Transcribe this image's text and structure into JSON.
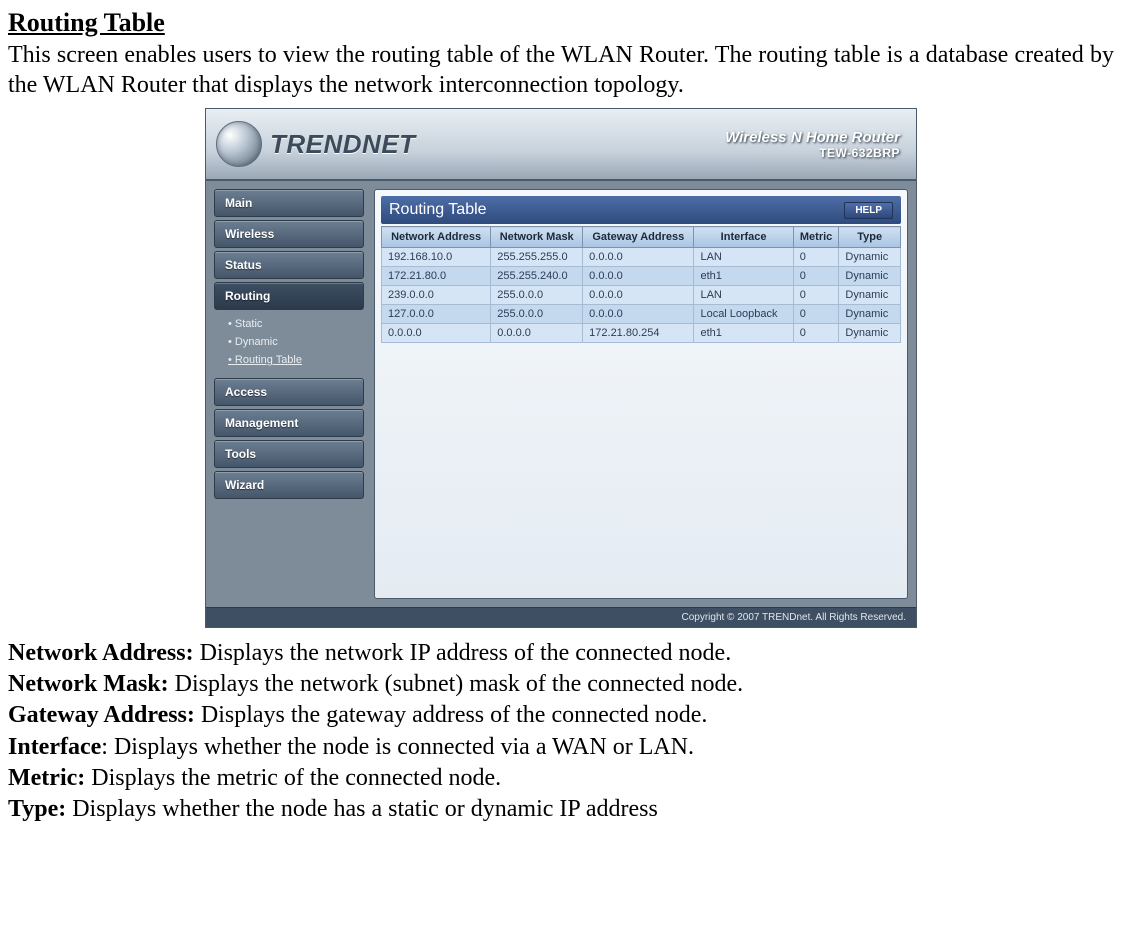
{
  "doc": {
    "title": "Routing Table",
    "intro": "This screen enables users to view the routing table of the WLAN Router. The routing table is a database created by the WLAN Router that displays the network interconnection topology."
  },
  "header": {
    "brand": "TRENDNET",
    "product_line1": "Wireless N Home Router",
    "product_line2": "TEW-632BRP"
  },
  "sidebar": {
    "items": [
      {
        "label": "Main"
      },
      {
        "label": "Wireless"
      },
      {
        "label": "Status"
      },
      {
        "label": "Routing"
      },
      {
        "label": "Access"
      },
      {
        "label": "Management"
      },
      {
        "label": "Tools"
      },
      {
        "label": "Wizard"
      }
    ],
    "routing_sub": [
      {
        "label": "Static"
      },
      {
        "label": "Dynamic"
      },
      {
        "label": "Routing Table"
      }
    ]
  },
  "panel": {
    "title": "Routing Table",
    "help_label": "HELP",
    "columns": {
      "c0": "Network Address",
      "c1": "Network Mask",
      "c2": "Gateway Address",
      "c3": "Interface",
      "c4": "Metric",
      "c5": "Type"
    },
    "rows": [
      {
        "c0": "192.168.10.0",
        "c1": "255.255.255.0",
        "c2": "0.0.0.0",
        "c3": "LAN",
        "c4": "0",
        "c5": "Dynamic"
      },
      {
        "c0": "172.21.80.0",
        "c1": "255.255.240.0",
        "c2": "0.0.0.0",
        "c3": "eth1",
        "c4": "0",
        "c5": "Dynamic"
      },
      {
        "c0": "239.0.0.0",
        "c1": "255.0.0.0",
        "c2": "0.0.0.0",
        "c3": "LAN",
        "c4": "0",
        "c5": "Dynamic"
      },
      {
        "c0": "127.0.0.0",
        "c1": "255.0.0.0",
        "c2": "0.0.0.0",
        "c3": "Local Loopback",
        "c4": "0",
        "c5": "Dynamic"
      },
      {
        "c0": "0.0.0.0",
        "c1": "0.0.0.0",
        "c2": "172.21.80.254",
        "c3": "eth1",
        "c4": "0",
        "c5": "Dynamic"
      }
    ]
  },
  "footer": {
    "copyright": "Copyright © 2007 TRENDnet. All Rights Reserved."
  },
  "definitions": [
    {
      "term": "Network Address:",
      "desc": " Displays the network IP address of the connected node."
    },
    {
      "term": "Network Mask:",
      "desc": " Displays the network (subnet) mask of the connected node."
    },
    {
      "term": "Gateway Address:",
      "desc": " Displays the gateway address of the connected node."
    },
    {
      "term": "Interface",
      "desc": ": Displays whether the node is connected via a WAN or LAN."
    },
    {
      "term": "Metric:",
      "desc": " Displays the metric of the connected node."
    },
    {
      "term": "Type:",
      "desc": " Displays whether the node has a static or dynamic IP address"
    }
  ]
}
